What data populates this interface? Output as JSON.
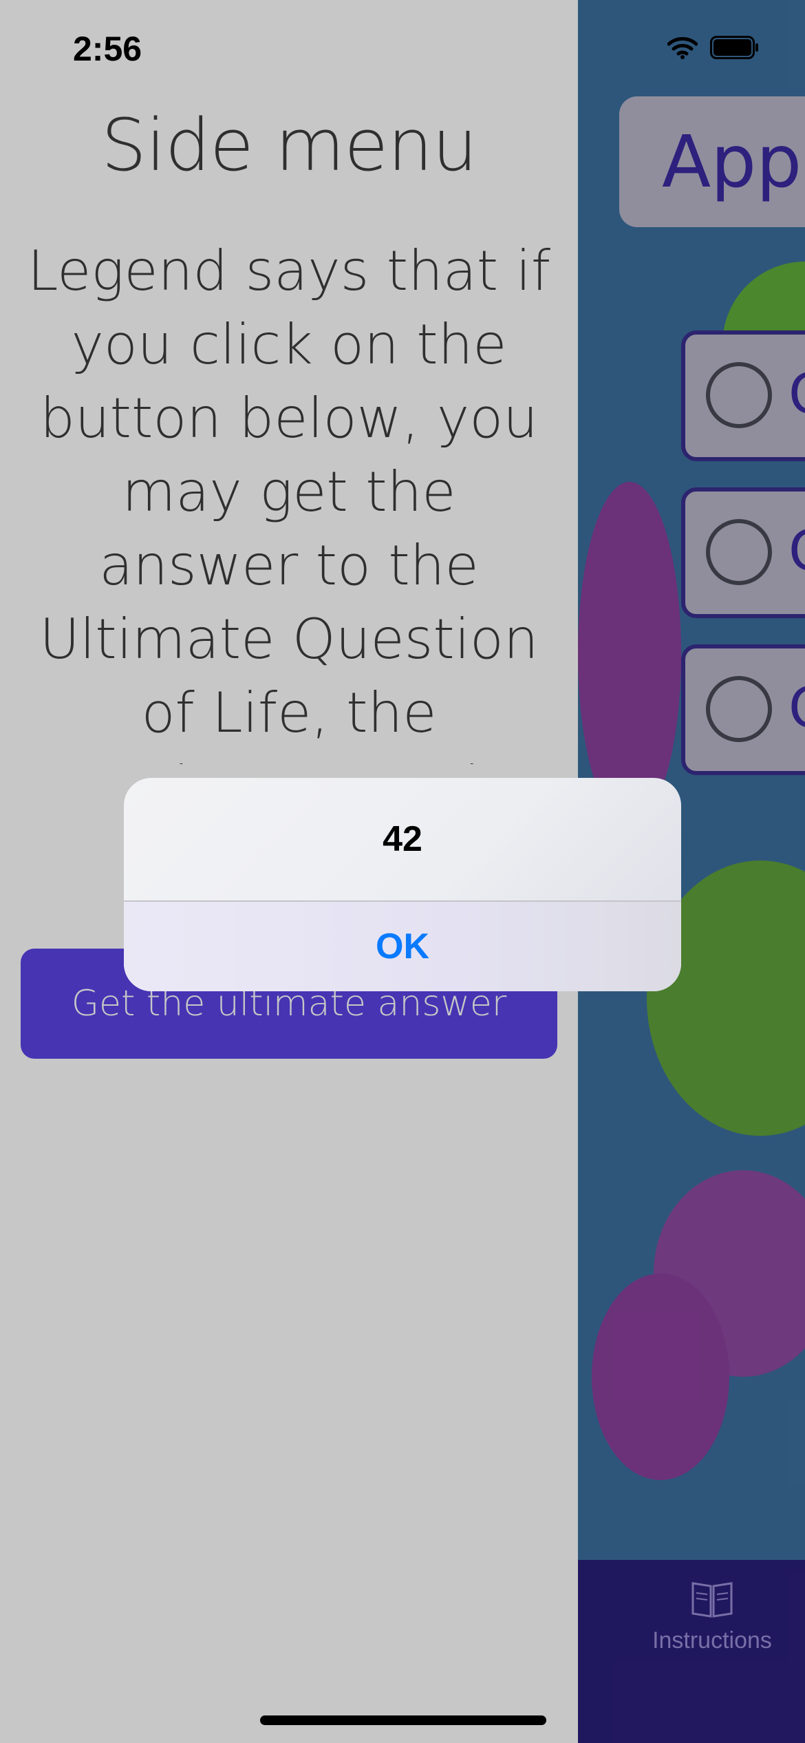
{
  "status_bar": {
    "time": "2:56",
    "icons": [
      "wifi-icon",
      "battery-icon"
    ]
  },
  "background_app": {
    "title_partial": "Appl",
    "options_partial": [
      "C",
      "C",
      "C"
    ],
    "tab_bar": {
      "items": [
        {
          "icon": "book-icon",
          "label": "Instructions"
        }
      ]
    }
  },
  "side_menu": {
    "title": "Side menu",
    "body": "Legend says that if you click on the button below, you may get the answer to the Ultimate Question of Life, the Universe, and Everything.",
    "button_label": "Get the ultimate answer",
    "accent_color": "#5a43e6"
  },
  "alert": {
    "message": "42",
    "ok_label": "OK",
    "ok_color": "#0a7aff"
  }
}
